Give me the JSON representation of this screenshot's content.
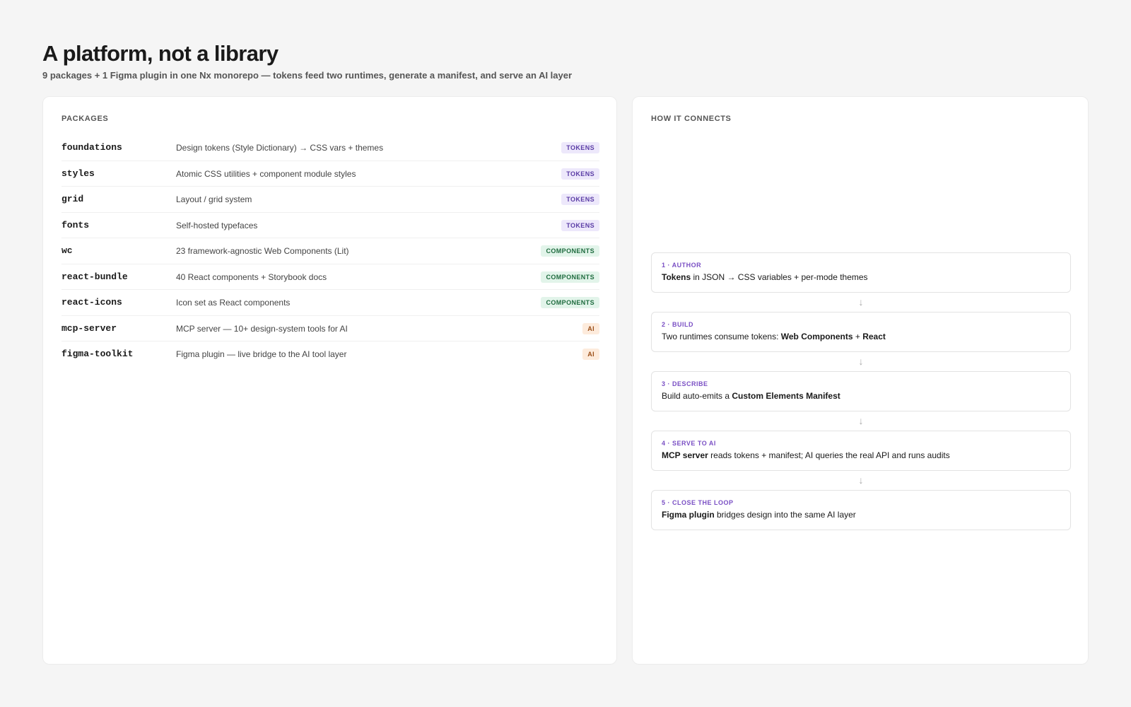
{
  "header": {
    "title": "A platform, not a library",
    "subtitle": "9 packages + 1 Figma plugin in one Nx monorepo — tokens feed two runtimes, generate a manifest, and serve an AI layer"
  },
  "packages": {
    "label": "PACKAGES",
    "items": [
      {
        "name": "foundations",
        "desc": "Design tokens (Style Dictionary) → CSS vars + themes",
        "badge": "TOKENS",
        "kind": "tokens"
      },
      {
        "name": "styles",
        "desc": "Atomic CSS utilities + component module styles",
        "badge": "TOKENS",
        "kind": "tokens"
      },
      {
        "name": "grid",
        "desc": "Layout / grid system",
        "badge": "TOKENS",
        "kind": "tokens"
      },
      {
        "name": "fonts",
        "desc": "Self-hosted typefaces",
        "badge": "TOKENS",
        "kind": "tokens"
      },
      {
        "name": "wc",
        "desc": "23 framework-agnostic Web Components (Lit)",
        "badge": "COMPONENTS",
        "kind": "components"
      },
      {
        "name": "react-bundle",
        "desc": "40 React components + Storybook docs",
        "badge": "COMPONENTS",
        "kind": "components"
      },
      {
        "name": "react-icons",
        "desc": "Icon set as React components",
        "badge": "COMPONENTS",
        "kind": "components"
      },
      {
        "name": "mcp-server",
        "desc": "MCP server — 10+ design-system tools for AI",
        "badge": "AI",
        "kind": "ai"
      },
      {
        "name": "figma-toolkit",
        "desc": "Figma plugin — live bridge to the AI tool layer",
        "badge": "AI",
        "kind": "ai"
      }
    ]
  },
  "connects": {
    "label": "HOW IT CONNECTS",
    "arrow": "↓",
    "steps": [
      {
        "label": "1 · AUTHOR",
        "parts": [
          {
            "t": "Tokens",
            "b": true
          },
          {
            "t": " in JSON → CSS variables + per-mode themes",
            "b": false
          }
        ]
      },
      {
        "label": "2 · BUILD",
        "parts": [
          {
            "t": "Two runtimes consume tokens: ",
            "b": false
          },
          {
            "t": "Web Components",
            "b": true
          },
          {
            "t": " + ",
            "b": false
          },
          {
            "t": "React",
            "b": true
          }
        ]
      },
      {
        "label": "3 · DESCRIBE",
        "parts": [
          {
            "t": "Build auto-emits a ",
            "b": false
          },
          {
            "t": "Custom Elements Manifest",
            "b": true
          }
        ]
      },
      {
        "label": "4 · SERVE TO AI",
        "parts": [
          {
            "t": "MCP server",
            "b": true
          },
          {
            "t": " reads tokens + manifest; AI queries the real API and runs audits",
            "b": false
          }
        ]
      },
      {
        "label": "5 · CLOSE THE LOOP",
        "parts": [
          {
            "t": "Figma plugin",
            "b": true
          },
          {
            "t": " bridges design into the same AI layer",
            "b": false
          }
        ]
      }
    ]
  }
}
